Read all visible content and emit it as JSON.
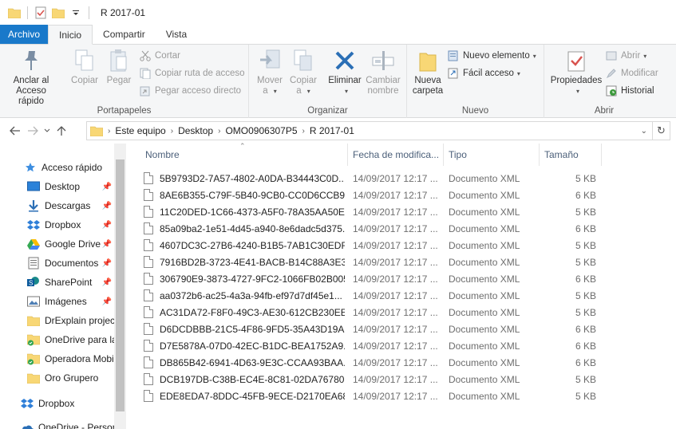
{
  "title": "R 2017-01",
  "tabs": [
    {
      "label": "Archivo"
    },
    {
      "label": "Inicio"
    },
    {
      "label": "Compartir"
    },
    {
      "label": "Vista"
    }
  ],
  "ribbon": {
    "portapapeles": {
      "label": "Portapapeles",
      "pin": "Anclar al\nAcceso rápido",
      "pin_line1": "Anclar al",
      "pin_line2": "Acceso rápido",
      "copy": "Copiar",
      "paste": "Pegar",
      "cut": "Cortar",
      "copy_path": "Copiar ruta de acceso",
      "paste_shortcut": "Pegar acceso directo"
    },
    "organizar": {
      "label": "Organizar",
      "move_line1": "Mover",
      "move_line2": "a",
      "copy_line1": "Copiar",
      "copy_line2": "a",
      "delete": "Eliminar",
      "rename_line1": "Cambiar",
      "rename_line2": "nombre"
    },
    "nuevo": {
      "label": "Nuevo",
      "new_folder_line1": "Nueva",
      "new_folder_line2": "carpeta",
      "new_item": "Nuevo elemento",
      "easy_access": "Fácil acceso"
    },
    "abrir": {
      "label": "Abrir",
      "properties": "Propiedades",
      "open": "Abrir",
      "modify": "Modificar",
      "history": "Historial"
    }
  },
  "address": {
    "crumbs": [
      "Este equipo",
      "Desktop",
      "OMO0906307P5",
      "R 2017-01"
    ]
  },
  "nav": {
    "items": [
      {
        "label": "Acceso rápido",
        "icon": "star-icon"
      },
      {
        "label": "Desktop",
        "icon": "desktop-icon",
        "pinned": true
      },
      {
        "label": "Descargas",
        "icon": "download-icon",
        "pinned": true
      },
      {
        "label": "Dropbox",
        "icon": "dropbox-icon",
        "pinned": true
      },
      {
        "label": "Google Drive",
        "icon": "google-drive-icon",
        "pinned": true
      },
      {
        "label": "Documentos",
        "icon": "documents-icon",
        "pinned": true
      },
      {
        "label": "SharePoint",
        "icon": "sharepoint-icon",
        "pinned": true
      },
      {
        "label": "Imágenes",
        "icon": "pictures-icon",
        "pinned": true
      },
      {
        "label": "DrExplain projec",
        "icon": "folder-icon"
      },
      {
        "label": "OneDrive para la",
        "icon": "onedrive-folder-icon"
      },
      {
        "label": "Operadora Mobi",
        "icon": "onedrive-folder-icon"
      },
      {
        "label": "Oro Grupero",
        "icon": "folder-icon"
      },
      {
        "label": "Dropbox",
        "icon": "dropbox-icon"
      },
      {
        "label": "OneDrive - Persor",
        "icon": "onedrive-icon"
      }
    ],
    "pin_glyph": "📌"
  },
  "columns": {
    "name": "Nombre",
    "date": "Fecha de modifica...",
    "type": "Tipo",
    "size": "Tamaño"
  },
  "files": [
    {
      "name": "5B9793D2-7A57-4802-A0DA-B34443C0D...",
      "date": "14/09/2017 12:17 ...",
      "type": "Documento XML",
      "size": "5 KB"
    },
    {
      "name": "8AE6B355-C79F-5B40-9CB0-CC0D6CCB9...",
      "date": "14/09/2017 12:17 ...",
      "type": "Documento XML",
      "size": "6 KB"
    },
    {
      "name": "11C20DED-1C66-4373-A5F0-78A35AA50E...",
      "date": "14/09/2017 12:17 ...",
      "type": "Documento XML",
      "size": "5 KB"
    },
    {
      "name": "85a09ba2-1e51-4d45-a940-8e6dadc5d375...",
      "date": "14/09/2017 12:17 ...",
      "type": "Documento XML",
      "size": "6 KB"
    },
    {
      "name": "4607DC3C-27B6-4240-B1B5-7AB1C30EDF...",
      "date": "14/09/2017 12:17 ...",
      "type": "Documento XML",
      "size": "5 KB"
    },
    {
      "name": "7916BD2B-3723-4E41-BACB-B14C88A3E3...",
      "date": "14/09/2017 12:17 ...",
      "type": "Documento XML",
      "size": "5 KB"
    },
    {
      "name": "306790E9-3873-4727-9FC2-1066FB02B005...",
      "date": "14/09/2017 12:17 ...",
      "type": "Documento XML",
      "size": "6 KB"
    },
    {
      "name": "aa0372b6-ac25-4a3a-94fb-ef97d7df45e1...",
      "date": "14/09/2017 12:17 ...",
      "type": "Documento XML",
      "size": "5 KB"
    },
    {
      "name": "AC31DA72-F8F0-49C3-AE30-612CB230EE...",
      "date": "14/09/2017 12:17 ...",
      "type": "Documento XML",
      "size": "5 KB"
    },
    {
      "name": "D6DCDBBB-21C5-4F86-9FD5-35A43D19A...",
      "date": "14/09/2017 12:17 ...",
      "type": "Documento XML",
      "size": "6 KB"
    },
    {
      "name": "D7E5878A-07D0-42EC-B1DC-BEA1752A9...",
      "date": "14/09/2017 12:17 ...",
      "type": "Documento XML",
      "size": "6 KB"
    },
    {
      "name": "DB865B42-6941-4D63-9E3C-CCAA93BAA...",
      "date": "14/09/2017 12:17 ...",
      "type": "Documento XML",
      "size": "6 KB"
    },
    {
      "name": "DCB197DB-C38B-EC4E-8C81-02DA76780...",
      "date": "14/09/2017 12:17 ...",
      "type": "Documento XML",
      "size": "5 KB"
    },
    {
      "name": "EDE8EDA7-8DDC-45FB-9ECE-D2170EA68...",
      "date": "14/09/2017 12:17 ...",
      "type": "Documento XML",
      "size": "5 KB"
    }
  ],
  "colors": {
    "file_tab": "#1979ca",
    "folder": "#f8d775",
    "ribbon_bg": "#f5f6f7",
    "column_header_text": "#4c607a",
    "delete_x": "#2b6fb6"
  }
}
